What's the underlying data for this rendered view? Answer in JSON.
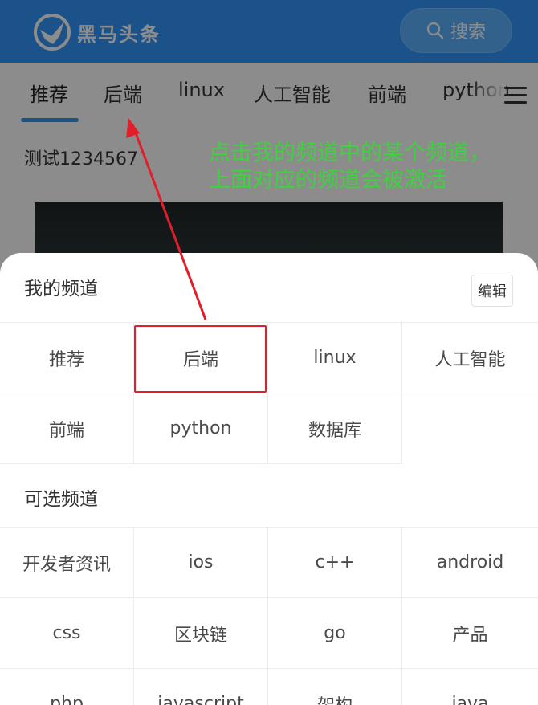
{
  "header": {
    "logo_text": "黑马头条",
    "search_label": "搜索"
  },
  "tabs": [
    {
      "label": "推荐",
      "active": true
    },
    {
      "label": "后端",
      "active": false
    },
    {
      "label": "linux",
      "active": false
    },
    {
      "label": "人工智能",
      "active": false
    },
    {
      "label": "前端",
      "active": false
    },
    {
      "label": "python",
      "active": false
    }
  ],
  "article": {
    "title": "测试1234567"
  },
  "annotation": {
    "line1": "点击我的频道中的某个频道，",
    "line2": "上面对应的频道会被激活"
  },
  "my_channels": {
    "title": "我的频道",
    "edit_label": "编辑",
    "items": [
      "推荐",
      "后端",
      "linux",
      "人工智能",
      "前端",
      "python",
      "数据库"
    ]
  },
  "optional_channels": {
    "title": "可选频道",
    "items": [
      "开发者资讯",
      "ios",
      "c++",
      "android",
      "css",
      "区块链",
      "go",
      "产品",
      "php",
      "javascript",
      "架构",
      "java"
    ]
  },
  "colors": {
    "brand_blue": "#3296fa",
    "annotation_green": "#3fd13f",
    "annotation_red": "#e21e2c"
  }
}
